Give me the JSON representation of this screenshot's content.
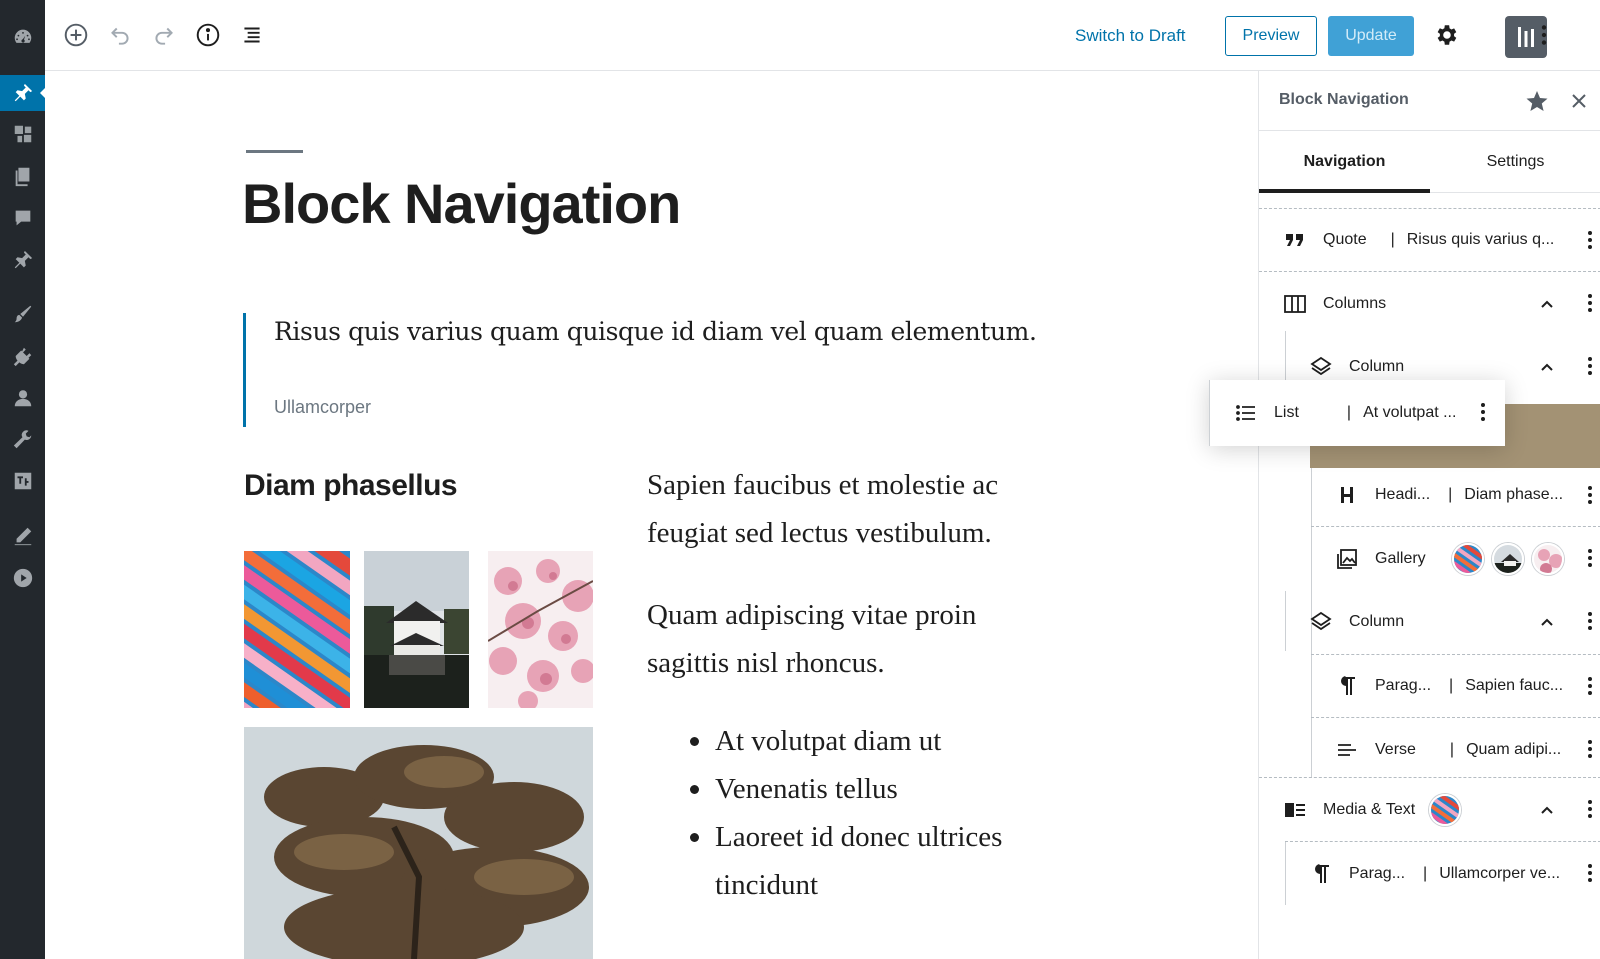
{
  "toolbar": {
    "switch_draft": "Switch to Draft",
    "preview": "Preview",
    "update": "Update"
  },
  "post": {
    "title": "Block Navigation",
    "quote": "Risus quis varius quam quisque id diam vel quam elementum.",
    "quote_cite": "Ullamcorper",
    "col_heading": "Diam phasellus",
    "paragraph": "Sapien faucibus et molestie ac feugiat sed lectus vestibulum.",
    "verse_line1": "Quam adipiscing vitae proin",
    "verse_line2": "sagittis nisl rhoncus.",
    "list": [
      "At volutpat diam ut",
      "Venenatis tellus",
      "Laoreet id donec ultrices tincidunt"
    ]
  },
  "panel": {
    "title": "Block Navigation",
    "tabs": [
      "Navigation",
      "Settings"
    ],
    "items": {
      "quote": {
        "label": "Quote",
        "sep": "|",
        "preview": "Risus quis varius q..."
      },
      "columns": {
        "label": "Columns"
      },
      "column1": {
        "label": "Column"
      },
      "heading": {
        "label": "Headi...",
        "sep": "|",
        "preview": "Diam phase..."
      },
      "gallery": {
        "label": "Gallery"
      },
      "column2": {
        "label": "Column"
      },
      "paragraph": {
        "label": "Parag...",
        "sep": "|",
        "preview": "Sapien fauc..."
      },
      "verse": {
        "label": "Verse",
        "sep": "|",
        "preview": "Quam adipi..."
      },
      "media_text": {
        "label": "Media & Text"
      },
      "paragraph2": {
        "label": "Parag...",
        "sep": "|",
        "preview": "Ullamcorper ve..."
      }
    },
    "drag_ghost": {
      "label": "List",
      "sep": "|",
      "preview": "At volutpat ..."
    }
  },
  "colors": {
    "accent": "#0073aa",
    "admin_bg": "#23282d",
    "drop_indicator": "#a39274"
  }
}
